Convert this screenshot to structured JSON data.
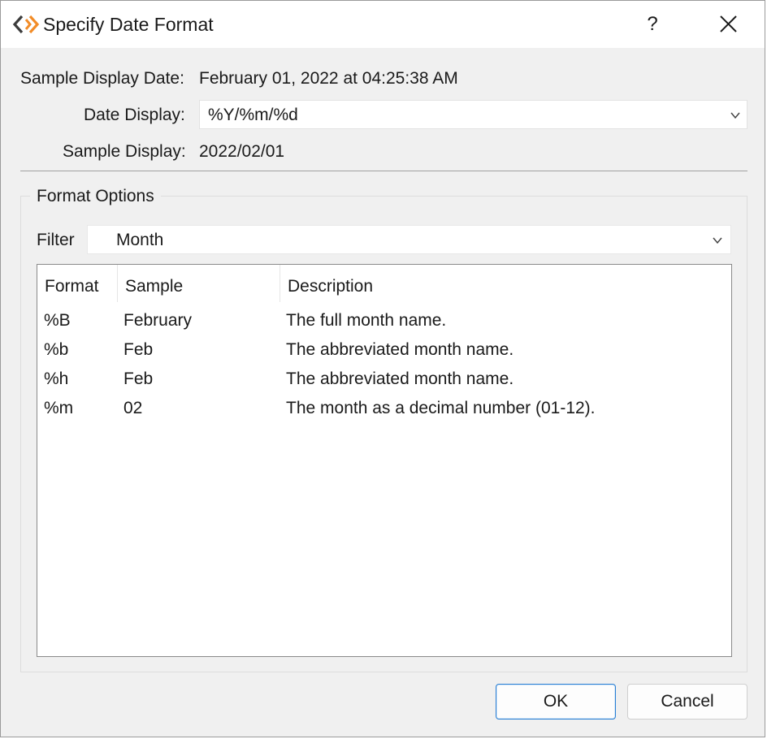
{
  "window": {
    "title": "Specify Date Format",
    "help_label": "?",
    "app_icon": "diamond-chevron-icon",
    "close_icon": "close-icon"
  },
  "sample_date": {
    "label": "Sample Display Date:",
    "value": "February 01, 2022 at 04:25:38 AM"
  },
  "date_display": {
    "label": "Date Display:",
    "value": "%Y/%m/%d"
  },
  "sample_display": {
    "label": "Sample Display:",
    "value": "2022/02/01"
  },
  "format_options": {
    "title": "Format Options",
    "filter": {
      "label": "Filter",
      "value": "Month"
    },
    "table": {
      "columns": [
        "Format",
        "Sample",
        "Description"
      ],
      "rows": [
        {
          "format": "%B",
          "sample": "February",
          "description": "The full month name."
        },
        {
          "format": "%b",
          "sample": "Feb",
          "description": "The abbreviated month name."
        },
        {
          "format": "%h",
          "sample": "Feb",
          "description": "The abbreviated month name."
        },
        {
          "format": "%m",
          "sample": "02",
          "description": "The month as a decimal number (01-12)."
        }
      ]
    }
  },
  "buttons": {
    "ok": "OK",
    "cancel": "Cancel"
  },
  "colors": {
    "dialog_bg": "#f0f0f0",
    "titlebar_bg": "#ffffff",
    "default_button_border": "#2a7fd4",
    "icon_orange": "#f28c28",
    "icon_dark": "#3c3c3c"
  }
}
